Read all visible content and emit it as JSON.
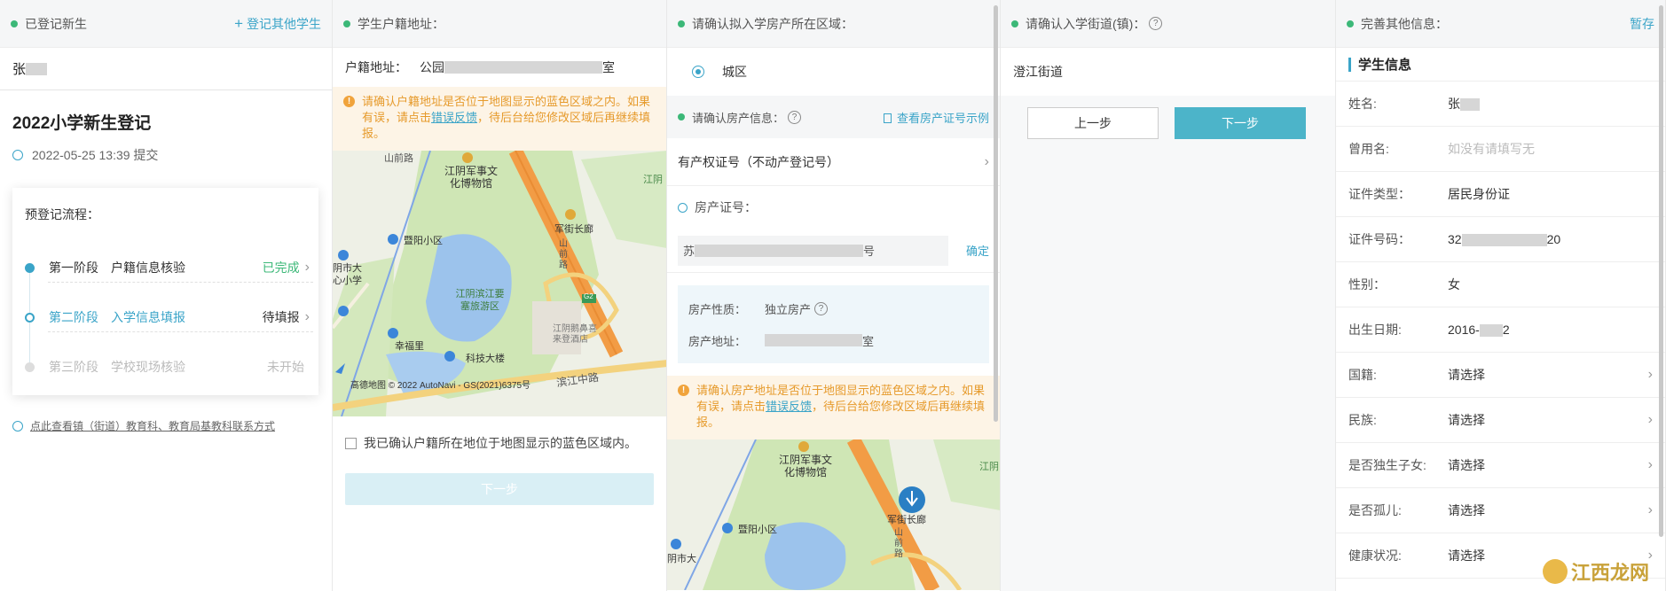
{
  "panel1": {
    "header_title": "已登记新生",
    "register_other": "登记其他学生",
    "student_tab": "张",
    "form_title": "2022小学新生登记",
    "submitted_time": "2022-05-25 13:39 提交",
    "flow_title": "预登记流程：",
    "steps": [
      {
        "phase": "第一阶段",
        "name": "户籍信息核验",
        "status": "已完成"
      },
      {
        "phase": "第二阶段",
        "name": "入学信息填报",
        "status": "待填报"
      },
      {
        "phase": "第三阶段",
        "name": "学校现场核验",
        "status": "未开始"
      }
    ],
    "contact_link": "点此查看镇（街道）教育科、教育局基教科联系方式",
    "colors": {
      "accent": "#3aa4c8",
      "done": "#3cb878",
      "dot": "#3cb878"
    }
  },
  "panel2": {
    "header_title": "学生户籍地址：",
    "address_label": "户籍地址：",
    "address_prefix": "公园",
    "address_suffix": "室",
    "warning_pre": "请确认户籍地址是否位于地图显示的蓝色区域之内。如果有误，请点击",
    "warning_link": "错误反馈",
    "warning_post": "，待后台给您修改区域后再继续填报。",
    "map_labels": {
      "road1": "山前路",
      "museum": "江阴军事文化博物馆",
      "jiangyin": "江阴",
      "plaza": "军街长廊",
      "school_area": "暨阳小区",
      "city_school": "阴市大心小学",
      "park": "江阴滨江要塞旅游区",
      "hill": "山前路",
      "xingfuli": "幸福里",
      "hotel": "江阴鹅鼻喜来登酒店",
      "tech": "科技大楼",
      "road2": "滨江中路",
      "g2": "G2",
      "copyright": "高德地图 © 2022 AutoNavi - GS(2021)6375号"
    },
    "confirm_check": "我已确认户籍所在地位于地图显示的蓝色区域内。",
    "next_btn": "下一步"
  },
  "panel3": {
    "header_title": "请确认拟入学房产所在区域：",
    "area_option": "城区",
    "house_info": "请确认房产信息：",
    "example_link": "查看房产证号示例",
    "cert_type": "有产权证号（不动产登记号）",
    "cert_no_label": "房产证号：",
    "cert_prefix": "苏",
    "cert_suffix": "号",
    "confirm_btn": "确定",
    "property_nature_label": "房产性质：",
    "property_nature": "独立房产",
    "property_addr_label": "房产地址：",
    "property_addr_suffix": "室",
    "warning_pre": "请确认房产地址是否位于地图显示的蓝色区域之内。如果有误，请点击",
    "warning_link": "错误反馈",
    "warning_post": "，待后台给您修改区域后再继续填报。",
    "map_labels": {
      "museum": "江阴军事文化博物馆",
      "jiangyin": "江阴",
      "plaza": "军街长廊",
      "school_area": "暨阳小区",
      "hill": "山前路",
      "city": "阴市大"
    }
  },
  "panel4": {
    "header_title": "请确认入学街道(镇)：",
    "street": "澄江街道",
    "prev_btn": "上一步",
    "next_btn": "下一步"
  },
  "panel5": {
    "header_title": "完善其他信息：",
    "save_btn": "暂存",
    "section_title": "学生信息",
    "fields": [
      {
        "label": "姓名:",
        "value": "张"
      },
      {
        "label": "曾用名:",
        "value": "如没有请填写无"
      },
      {
        "label": "证件类型：",
        "value": "居民身份证"
      },
      {
        "label": "证件号码：",
        "value": "32",
        "value_suffix": "20"
      },
      {
        "label": "性别：",
        "value": "女"
      },
      {
        "label": "出生日期:",
        "value": "2016-",
        "value_suffix": "2"
      },
      {
        "label": "国籍:",
        "value": "请选择"
      },
      {
        "label": "民族:",
        "value": "请选择"
      },
      {
        "label": "是否独生子女:",
        "value": "请选择"
      },
      {
        "label": "是否孤儿:",
        "value": "请选择"
      },
      {
        "label": "健康状况:",
        "value": "请选择"
      }
    ],
    "watermark": "江西龙网"
  }
}
